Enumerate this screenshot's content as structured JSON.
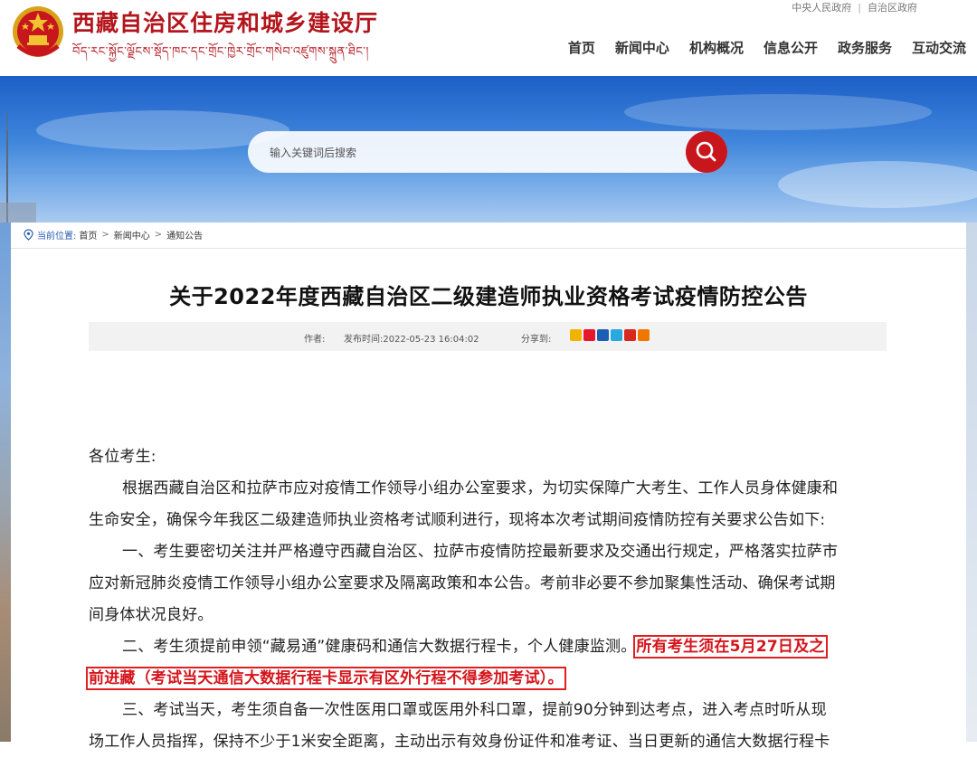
{
  "site": {
    "title": "西藏自治区住房和城乡建设厅",
    "subtitle": "བོད་རང་སྐྱོང་ལྗོངས་སྡོད་ཁང་དང་གྲོང་ཁྱེར་གྲོང་གསེབ་འཛུགས་སྐྲུན་ཐིང་།",
    "top_links": [
      "中央人民政府",
      "自治区政府"
    ],
    "nav": [
      "首页",
      "新闻中心",
      "机构概况",
      "信息公开",
      "政务服务",
      "互动交流"
    ]
  },
  "search": {
    "placeholder": "输入关键词后搜索"
  },
  "breadcrumb": {
    "label": "当前位置:",
    "items": [
      "首页",
      "新闻中心",
      "通知公告"
    ]
  },
  "article": {
    "title": "关于2022年度西藏自治区二级建造师执业资格考试疫情防控公告",
    "author_label": "作者:",
    "date": "发布时间:2022-05-23 16:04:02",
    "share_label": "分享到:",
    "share_icons": [
      "qzone-icon",
      "weibo-icon",
      "renren-icon",
      "qq-weibo-icon",
      "tieba-icon",
      "more-icon"
    ],
    "lines": [
      "各位考生:",
      "根据西藏自治区和拉萨市应对疫情工作领导小组办公室要求，为切实保障广大考生、工作人员身体健康和",
      "生命安全，确保今年我区二级建造师执业资格考试顺利进行，现将本次考试期间疫情防控有关要求公告如下:",
      "一、考生要密切关注并严格遵守西藏自治区、拉萨市疫情防控最新要求及交通出行规定，严格落实拉萨市",
      "应对新冠肺炎疫情工作领导小组办公室要求及隔离政策和本公告。考前非必要不参加聚集性活动、确保考试期",
      "间身体状况良好。",
      "二、考生须提前申领“藏易通”健康码和通信大数据行程卡，个人健康监测。",
      "三、考试当天，考生须自备一次性医用口罩或医用外科口罩，提前90分钟到达考点，进入考点时听从现",
      "场工作人员指挥，保持不少于1米安全距离，主动出示有效身份证件和准考证、当日更新的通信大数据行程卡"
    ],
    "highlight_1": "所有考生须在5月27日及之",
    "highlight_2": "前进藏（考试当天通信大数据行程卡显示有区外行程不得参加考试）。"
  },
  "colors": {
    "brand_red": "#b3151c",
    "search_red": "#c8161d",
    "highlight_red": "#d4141b",
    "link_blue": "#2a5db0"
  }
}
